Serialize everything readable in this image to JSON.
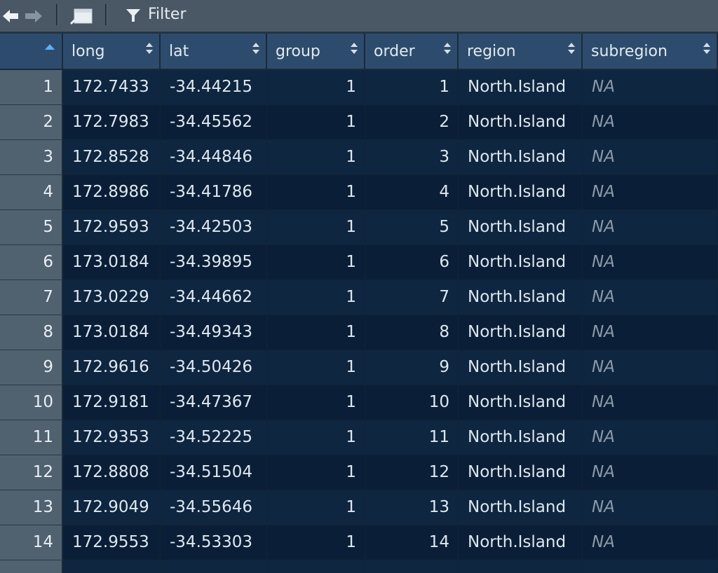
{
  "toolbar": {
    "back_icon": "arrow-left-icon",
    "forward_icon": "arrow-right-icon",
    "popout_icon": "open-in-new-window-icon",
    "filter_icon": "funnel-icon",
    "filter_label": "Filter"
  },
  "columns": [
    "long",
    "lat",
    "group",
    "order",
    "region",
    "subregion"
  ],
  "sort": {
    "column": "row-index",
    "direction": "ascending"
  },
  "rows": [
    {
      "idx": "1",
      "long": "172.7433",
      "lat": "-34.44215",
      "group": "1",
      "order": "1",
      "region": "North.Island",
      "subregion": "NA"
    },
    {
      "idx": "2",
      "long": "172.7983",
      "lat": "-34.45562",
      "group": "1",
      "order": "2",
      "region": "North.Island",
      "subregion": "NA"
    },
    {
      "idx": "3",
      "long": "172.8528",
      "lat": "-34.44846",
      "group": "1",
      "order": "3",
      "region": "North.Island",
      "subregion": "NA"
    },
    {
      "idx": "4",
      "long": "172.8986",
      "lat": "-34.41786",
      "group": "1",
      "order": "4",
      "region": "North.Island",
      "subregion": "NA"
    },
    {
      "idx": "5",
      "long": "172.9593",
      "lat": "-34.42503",
      "group": "1",
      "order": "5",
      "region": "North.Island",
      "subregion": "NA"
    },
    {
      "idx": "6",
      "long": "173.0184",
      "lat": "-34.39895",
      "group": "1",
      "order": "6",
      "region": "North.Island",
      "subregion": "NA"
    },
    {
      "idx": "7",
      "long": "173.0229",
      "lat": "-34.44662",
      "group": "1",
      "order": "7",
      "region": "North.Island",
      "subregion": "NA"
    },
    {
      "idx": "8",
      "long": "173.0184",
      "lat": "-34.49343",
      "group": "1",
      "order": "8",
      "region": "North.Island",
      "subregion": "NA"
    },
    {
      "idx": "9",
      "long": "172.9616",
      "lat": "-34.50426",
      "group": "1",
      "order": "9",
      "region": "North.Island",
      "subregion": "NA"
    },
    {
      "idx": "10",
      "long": "172.9181",
      "lat": "-34.47367",
      "group": "1",
      "order": "10",
      "region": "North.Island",
      "subregion": "NA"
    },
    {
      "idx": "11",
      "long": "172.9353",
      "lat": "-34.52225",
      "group": "1",
      "order": "11",
      "region": "North.Island",
      "subregion": "NA"
    },
    {
      "idx": "12",
      "long": "172.8808",
      "lat": "-34.51504",
      "group": "1",
      "order": "12",
      "region": "North.Island",
      "subregion": "NA"
    },
    {
      "idx": "13",
      "long": "172.9049",
      "lat": "-34.55646",
      "group": "1",
      "order": "13",
      "region": "North.Island",
      "subregion": "NA"
    },
    {
      "idx": "14",
      "long": "172.9553",
      "lat": "-34.53303",
      "group": "1",
      "order": "14",
      "region": "North.Island",
      "subregion": "NA"
    }
  ]
}
